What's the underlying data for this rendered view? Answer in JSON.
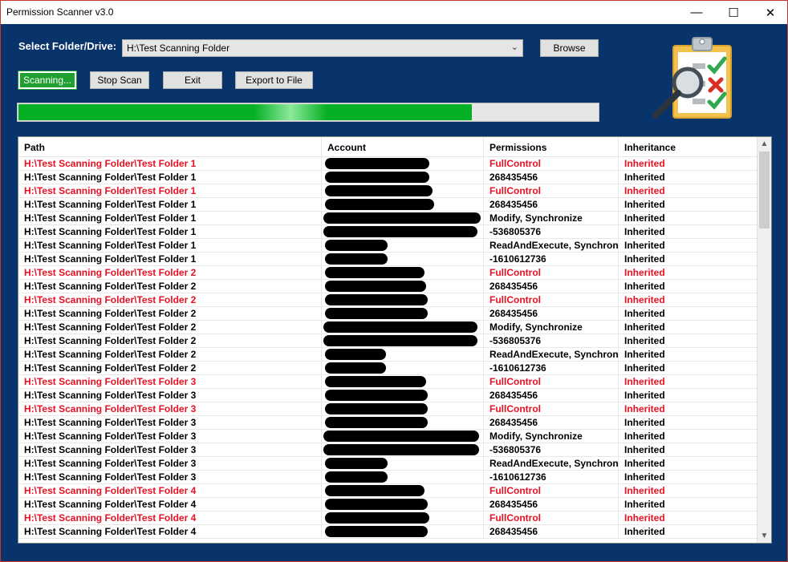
{
  "window": {
    "title": "Permission Scanner v3.0",
    "controls": {
      "minimize": "—",
      "maximize": "☐",
      "close": "✕"
    }
  },
  "form": {
    "select_label": "Select Folder/Drive:",
    "folder_value": "H:\\Test Scanning Folder",
    "browse_label": "Browse",
    "scan_label": "Scanning...",
    "stop_label": "Stop Scan",
    "exit_label": "Exit",
    "export_label": "Export to File"
  },
  "progress": {
    "fraction": 0.78
  },
  "colors": {
    "background": "#08346b",
    "progress_fill": "#06b025",
    "highlight_row_text": "#e81123",
    "scan_button": "#20a030"
  },
  "logo": {
    "icon": "clipboard-checklist-magnifier-icon"
  },
  "table": {
    "headers": {
      "path": "Path",
      "account": "Account",
      "permissions": "Permissions",
      "inheritance": "Inheritance"
    },
    "rows": [
      {
        "path": "H:\\Test Scanning Folder\\Test Folder 1",
        "permissions": "FullControl",
        "inheritance": "Inherited",
        "highlight": true
      },
      {
        "path": "H:\\Test Scanning Folder\\Test Folder 1",
        "permissions": "268435456",
        "inheritance": "Inherited",
        "highlight": false
      },
      {
        "path": "H:\\Test Scanning Folder\\Test Folder 1",
        "permissions": "FullControl",
        "inheritance": "Inherited",
        "highlight": true
      },
      {
        "path": "H:\\Test Scanning Folder\\Test Folder 1",
        "permissions": "268435456",
        "inheritance": "Inherited",
        "highlight": false
      },
      {
        "path": "H:\\Test Scanning Folder\\Test Folder 1",
        "permissions": "Modify, Synchronize",
        "inheritance": "Inherited",
        "highlight": false
      },
      {
        "path": "H:\\Test Scanning Folder\\Test Folder 1",
        "permissions": "-536805376",
        "inheritance": "Inherited",
        "highlight": false
      },
      {
        "path": "H:\\Test Scanning Folder\\Test Folder 1",
        "permissions": "ReadAndExecute, Synchronize",
        "inheritance": "Inherited",
        "highlight": false
      },
      {
        "path": "H:\\Test Scanning Folder\\Test Folder 1",
        "permissions": "-1610612736",
        "inheritance": "Inherited",
        "highlight": false
      },
      {
        "path": "H:\\Test Scanning Folder\\Test Folder 2",
        "permissions": "FullControl",
        "inheritance": "Inherited",
        "highlight": true
      },
      {
        "path": "H:\\Test Scanning Folder\\Test Folder 2",
        "permissions": "268435456",
        "inheritance": "Inherited",
        "highlight": false
      },
      {
        "path": "H:\\Test Scanning Folder\\Test Folder 2",
        "permissions": "FullControl",
        "inheritance": "Inherited",
        "highlight": true
      },
      {
        "path": "H:\\Test Scanning Folder\\Test Folder 2",
        "permissions": "268435456",
        "inheritance": "Inherited",
        "highlight": false
      },
      {
        "path": "H:\\Test Scanning Folder\\Test Folder 2",
        "permissions": "Modify, Synchronize",
        "inheritance": "Inherited",
        "highlight": false
      },
      {
        "path": "H:\\Test Scanning Folder\\Test Folder 2",
        "permissions": "-536805376",
        "inheritance": "Inherited",
        "highlight": false
      },
      {
        "path": "H:\\Test Scanning Folder\\Test Folder 2",
        "permissions": "ReadAndExecute, Synchronize",
        "inheritance": "Inherited",
        "highlight": false
      },
      {
        "path": "H:\\Test Scanning Folder\\Test Folder 2",
        "permissions": "-1610612736",
        "inheritance": "Inherited",
        "highlight": false
      },
      {
        "path": "H:\\Test Scanning Folder\\Test Folder 3",
        "permissions": "FullControl",
        "inheritance": "Inherited",
        "highlight": true
      },
      {
        "path": "H:\\Test Scanning Folder\\Test Folder 3",
        "permissions": "268435456",
        "inheritance": "Inherited",
        "highlight": false
      },
      {
        "path": "H:\\Test Scanning Folder\\Test Folder 3",
        "permissions": "FullControl",
        "inheritance": "Inherited",
        "highlight": true
      },
      {
        "path": "H:\\Test Scanning Folder\\Test Folder 3",
        "permissions": "268435456",
        "inheritance": "Inherited",
        "highlight": false
      },
      {
        "path": "H:\\Test Scanning Folder\\Test Folder 3",
        "permissions": "Modify, Synchronize",
        "inheritance": "Inherited",
        "highlight": false
      },
      {
        "path": "H:\\Test Scanning Folder\\Test Folder 3",
        "permissions": "-536805376",
        "inheritance": "Inherited",
        "highlight": false
      },
      {
        "path": "H:\\Test Scanning Folder\\Test Folder 3",
        "permissions": "ReadAndExecute, Synchronize",
        "inheritance": "Inherited",
        "highlight": false
      },
      {
        "path": "H:\\Test Scanning Folder\\Test Folder 3",
        "permissions": "-1610612736",
        "inheritance": "Inherited",
        "highlight": false
      },
      {
        "path": "H:\\Test Scanning Folder\\Test Folder 4",
        "permissions": "FullControl",
        "inheritance": "Inherited",
        "highlight": true
      },
      {
        "path": "H:\\Test Scanning Folder\\Test Folder 4",
        "permissions": "268435456",
        "inheritance": "Inherited",
        "highlight": false
      },
      {
        "path": "H:\\Test Scanning Folder\\Test Folder 4",
        "permissions": "FullControl",
        "inheritance": "Inherited",
        "highlight": true
      },
      {
        "path": "H:\\Test Scanning Folder\\Test Folder 4",
        "permissions": "268435456",
        "inheritance": "Inherited",
        "highlight": false
      }
    ]
  },
  "scrollbar": {
    "up": "▲",
    "down": "▼"
  }
}
